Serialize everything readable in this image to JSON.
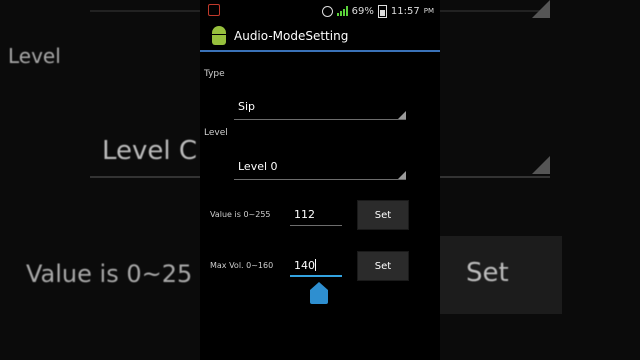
{
  "background": {
    "text_1": "Level",
    "text_2": "Level C",
    "text_3": "Value is 0~25",
    "text_4": "Set"
  },
  "status_bar": {
    "battery": "69%",
    "time": "11:57",
    "ampm": "PM"
  },
  "app": {
    "title": "Audio-ModeSetting"
  },
  "form": {
    "type_label": "Type",
    "type_value": "Sip",
    "level_label": "Level",
    "level_value": "Level 0",
    "value_label": "Value is 0~255",
    "value_input": "112",
    "value_set_label": "Set",
    "maxvol_label": "Max Vol. 0~160",
    "maxvol_input": "140",
    "maxvol_set_label": "Set"
  },
  "colors": {
    "accent": "#33a3e0",
    "title_underline": "#3a72b8",
    "signal": "#5bd33b"
  }
}
